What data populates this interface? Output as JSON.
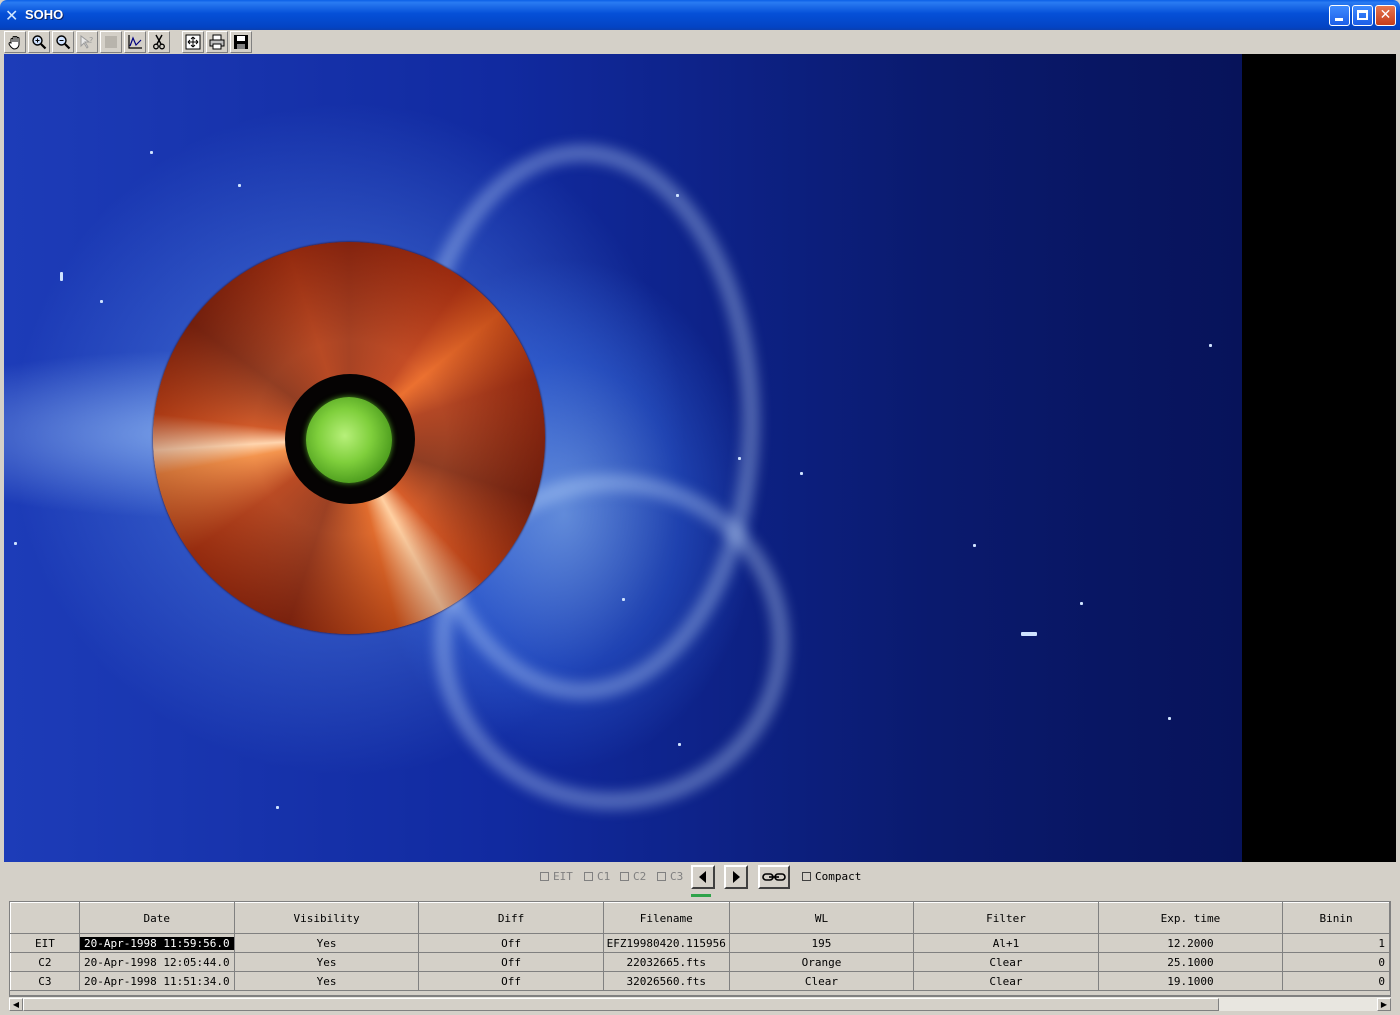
{
  "window": {
    "title": "SOHO",
    "icon": "x-wing-icon",
    "controls": [
      "minimize-icon",
      "maximize-icon",
      "close-icon"
    ]
  },
  "toolbar": {
    "tools": [
      {
        "name": "pan",
        "icon": "hand-icon",
        "enabled": true
      },
      {
        "name": "zoom-in",
        "icon": "zoom-in-icon",
        "enabled": true
      },
      {
        "name": "zoom-out",
        "icon": "zoom-out-icon",
        "enabled": true
      },
      {
        "name": "query",
        "icon": "help-icon",
        "enabled": false
      },
      {
        "name": "blank",
        "icon": "blank-icon",
        "enabled": false
      },
      {
        "name": "plot",
        "icon": "plot-icon",
        "enabled": true
      },
      {
        "name": "cut",
        "icon": "scissors-icon",
        "enabled": true
      },
      {
        "name": "fit",
        "icon": "fit-icon",
        "enabled": true
      },
      {
        "name": "print",
        "icon": "print-icon",
        "enabled": true
      },
      {
        "name": "save",
        "icon": "save-icon",
        "enabled": true
      }
    ]
  },
  "controls": {
    "layers": [
      {
        "label": "EIT",
        "checked": false,
        "enabled": false
      },
      {
        "label": "C1",
        "checked": false,
        "enabled": false
      },
      {
        "label": "C2",
        "checked": false,
        "enabled": false
      },
      {
        "label": "C3",
        "checked": false,
        "enabled": false
      }
    ],
    "compact_label": "Compact",
    "compact_checked": false
  },
  "table": {
    "columns": [
      "",
      "Date",
      "Visibility",
      "Diff",
      "Filename",
      "WL",
      "Filter",
      "Exp. time",
      "Binin"
    ],
    "rows": [
      {
        "instrument": "EIT",
        "date": "20-Apr-1998 11:59:56.0",
        "visibility": "Yes",
        "diff": "Off",
        "filename": "EFZ19980420.115956",
        "wl": "195",
        "filter": "Al+1",
        "exp_time": "12.2000",
        "binning": "1",
        "selected": true
      },
      {
        "instrument": "C2",
        "date": "20-Apr-1998 12:05:44.0",
        "visibility": "Yes",
        "diff": "Off",
        "filename": "22032665.fts",
        "wl": "Orange",
        "filter": "Clear",
        "exp_time": "25.1000",
        "binning": "0",
        "selected": false
      },
      {
        "instrument": "C3",
        "date": "20-Apr-1998 11:51:34.0",
        "visibility": "Yes",
        "diff": "Off",
        "filename": "32026560.fts",
        "wl": "Clear",
        "filter": "Clear",
        "exp_time": "19.1000",
        "binning": "0",
        "selected": false
      }
    ]
  },
  "colors": {
    "titlebar": "#0550d8",
    "lasco_c3": "#1d3cb8",
    "lasco_c2": "#c84010",
    "eit": "#7fcf3c",
    "selection": "#000000"
  }
}
